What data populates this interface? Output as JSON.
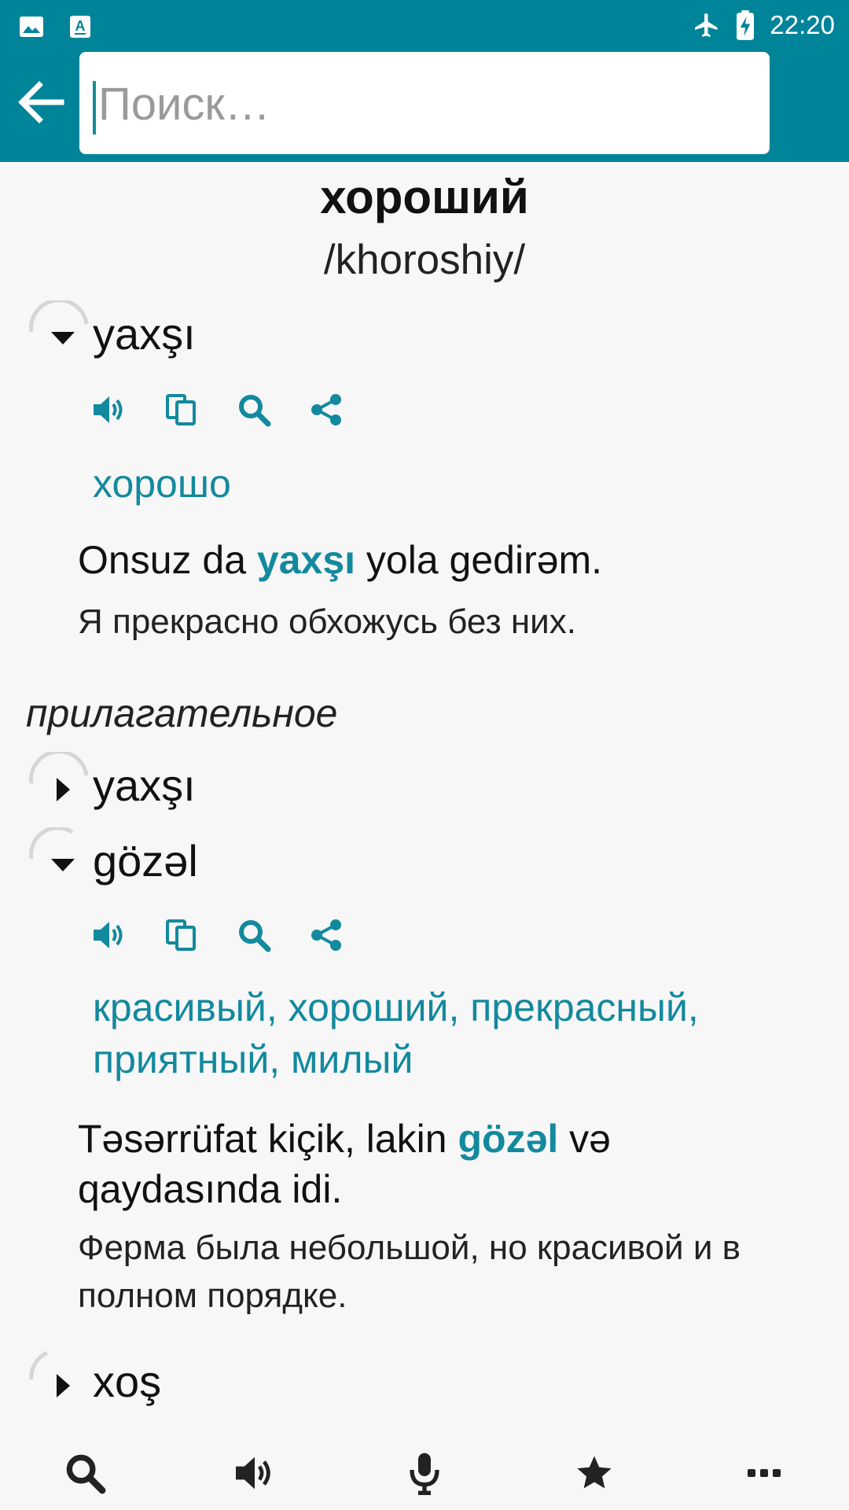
{
  "status_bar": {
    "time": "22:20",
    "left_icons": [
      "image-icon",
      "text-a-icon"
    ],
    "right_icons": [
      "airplane-icon",
      "battery-charging-icon"
    ]
  },
  "header": {
    "search_placeholder": "Поиск…",
    "search_value": "",
    "accent_color": "#00849a"
  },
  "entry": {
    "title": "хороший",
    "transliteration": "/khoroshiy/",
    "part_of_speech": "прилагательное",
    "items": [
      {
        "word": "yaxşı",
        "expanded": true,
        "translation": "хорошо",
        "example_before": "Onsuz da ",
        "example_highlight": "yaxşı",
        "example_after": " yola gedirəm.",
        "example_translation": "Я прекрасно обхожусь без них."
      },
      {
        "word": "yaxşı",
        "expanded": false
      },
      {
        "word": "gözəl",
        "expanded": true,
        "translation": "красивый, хороший, прекрасный, приятный, милый",
        "example_before": "Təsərrüfat kiçik, lakin ",
        "example_highlight": "gözəl",
        "example_after": " və qaydasında idi.",
        "example_translation": "Ферма была небольшой, но красивой и в полном порядке."
      },
      {
        "word": "xoş",
        "expanded": false
      }
    ],
    "action_icons": [
      "speaker-icon",
      "copy-icon",
      "search-icon",
      "share-icon"
    ]
  },
  "bottom_nav": [
    "search-icon",
    "speaker-icon",
    "microphone-icon",
    "star-icon",
    "more-icon"
  ]
}
